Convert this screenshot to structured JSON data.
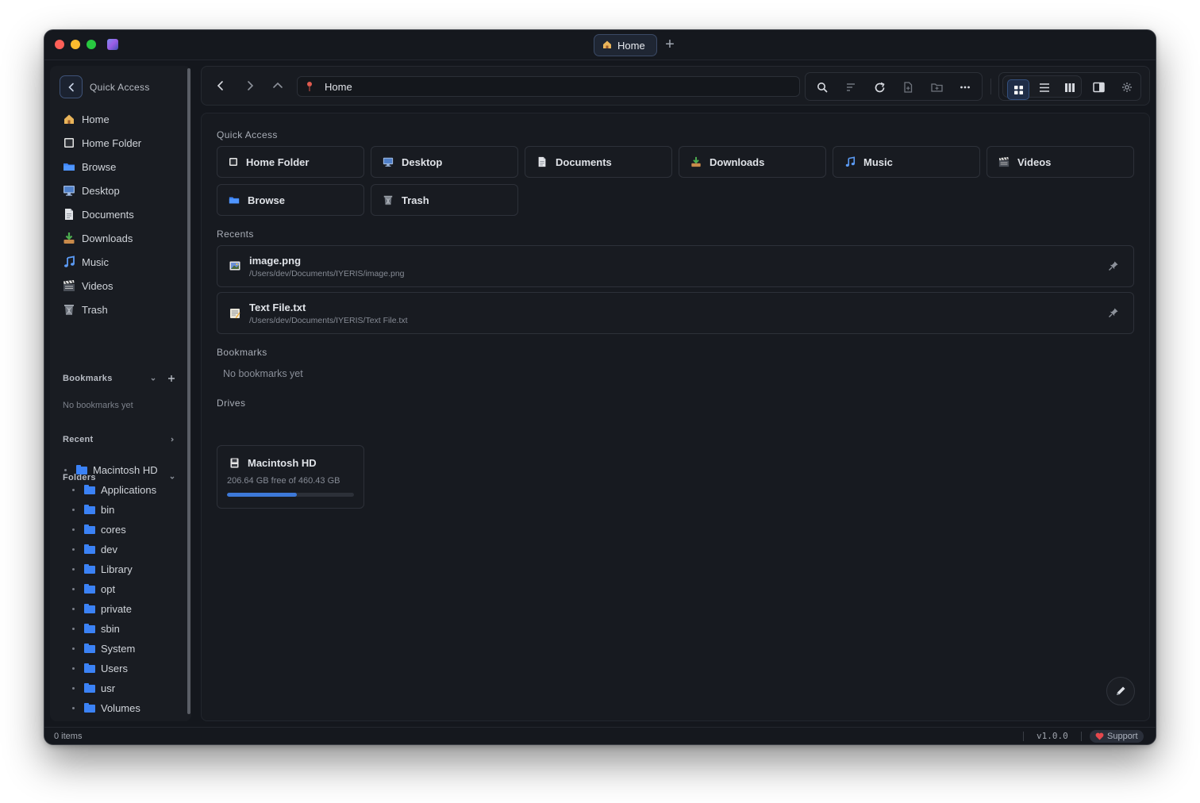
{
  "window": {
    "tab_label": "Home",
    "tab_icon": "home-icon"
  },
  "sidebar": {
    "header_label": "Quick Access",
    "items": [
      {
        "label": "Home",
        "icon": "home-icon"
      },
      {
        "label": "Home Folder",
        "icon": "home-folder-icon"
      },
      {
        "label": "Browse",
        "icon": "folder-icon"
      },
      {
        "label": "Desktop",
        "icon": "desktop-icon"
      },
      {
        "label": "Documents",
        "icon": "document-icon"
      },
      {
        "label": "Downloads",
        "icon": "download-icon"
      },
      {
        "label": "Music",
        "icon": "music-icon"
      },
      {
        "label": "Videos",
        "icon": "video-icon"
      },
      {
        "label": "Trash",
        "icon": "trash-icon"
      }
    ],
    "bookmarks_title": "Bookmarks",
    "bookmarks_empty": "No bookmarks yet",
    "recent_title": "Recent",
    "folders_title": "Folders",
    "tree_root": "Macintosh HD",
    "tree_children": [
      "Applications",
      "bin",
      "cores",
      "dev",
      "Library",
      "opt",
      "private",
      "sbin",
      "System",
      "Users",
      "usr",
      "Volumes"
    ]
  },
  "toolbar": {
    "path": "Home"
  },
  "main": {
    "quick_access_title": "Quick Access",
    "quick_access": [
      {
        "label": "Home Folder",
        "icon": "home-folder-icon"
      },
      {
        "label": "Desktop",
        "icon": "desktop-icon"
      },
      {
        "label": "Documents",
        "icon": "document-icon"
      },
      {
        "label": "Downloads",
        "icon": "download-icon"
      },
      {
        "label": "Music",
        "icon": "music-icon"
      },
      {
        "label": "Videos",
        "icon": "video-icon"
      },
      {
        "label": "Browse",
        "icon": "folder-icon"
      },
      {
        "label": "Trash",
        "icon": "trash-icon"
      }
    ],
    "recents_title": "Recents",
    "recents": [
      {
        "name": "image.png",
        "path": "/Users/dev/Documents/IYERIS/image.png",
        "icon": "image-file-icon"
      },
      {
        "name": "Text File.txt",
        "path": "/Users/dev/Documents/IYERIS/Text File.txt",
        "icon": "text-file-icon"
      }
    ],
    "bookmarks_title": "Bookmarks",
    "bookmarks_empty": "No bookmarks yet",
    "drives_title": "Drives",
    "drive": {
      "name": "Macintosh HD",
      "free_text": "206.64 GB free of 460.43 GB",
      "used_fraction": 0.551
    }
  },
  "status": {
    "items": "0 items",
    "version": "v1.0.0",
    "support": "Support"
  },
  "colors": {
    "accent": "#3b82f6",
    "folder": "#3b82f6",
    "background": "#14171d"
  }
}
